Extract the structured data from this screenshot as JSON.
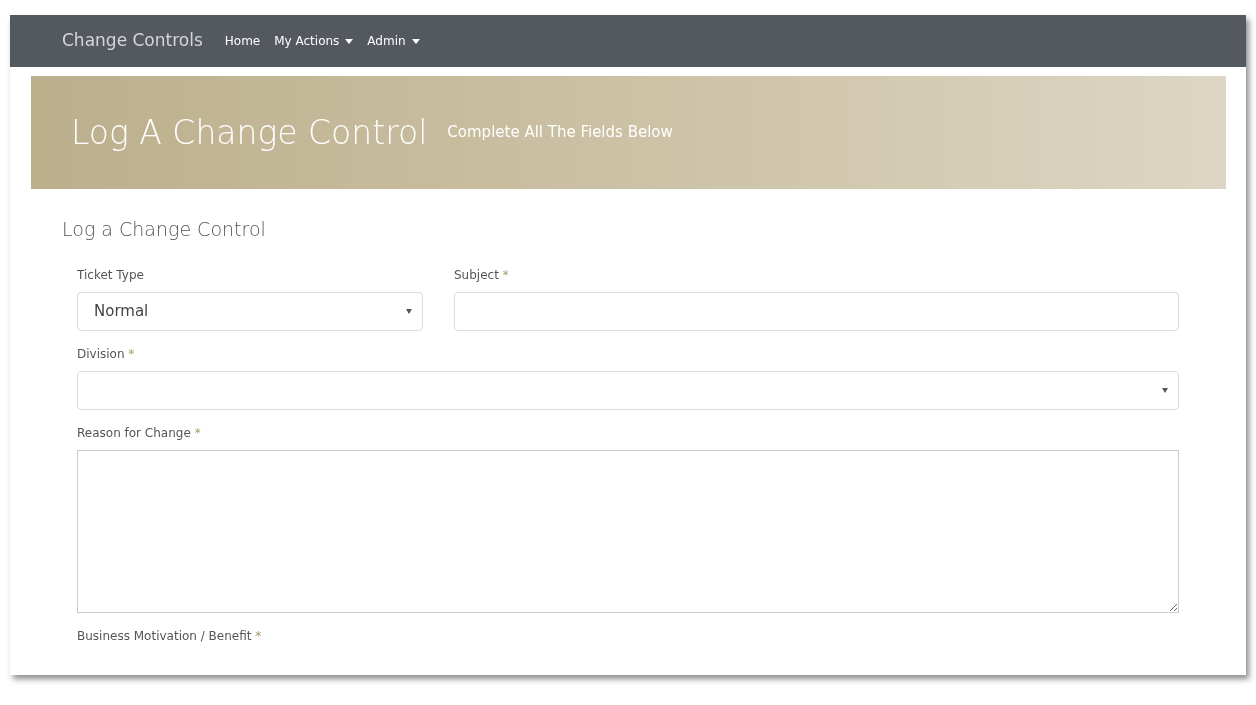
{
  "navbar": {
    "brand": "Change Controls",
    "items": [
      {
        "label": "Home",
        "dropdown": false
      },
      {
        "label": "My Actions",
        "dropdown": true
      },
      {
        "label": "Admin",
        "dropdown": true
      }
    ]
  },
  "banner": {
    "title": "Log A Change Control",
    "subtitle": "Complete All The Fields Below"
  },
  "form": {
    "title": "Log a Change Control",
    "rows": [
      [
        {
          "kind": "select",
          "label": "Ticket Type",
          "value": "Normal"
        },
        {
          "kind": "input",
          "label": "Subject",
          "required_mark": "*"
        }
      ],
      [
        {
          "kind": "select",
          "label": "Division",
          "required_mark": "*"
        }
      ],
      [
        {
          "kind": "textarea",
          "label": "Reason for Change",
          "required_mark": "*"
        }
      ],
      [
        {
          "kind": "label",
          "label": "Business Motivation / Benefit",
          "required_mark": "*"
        }
      ]
    ]
  }
}
